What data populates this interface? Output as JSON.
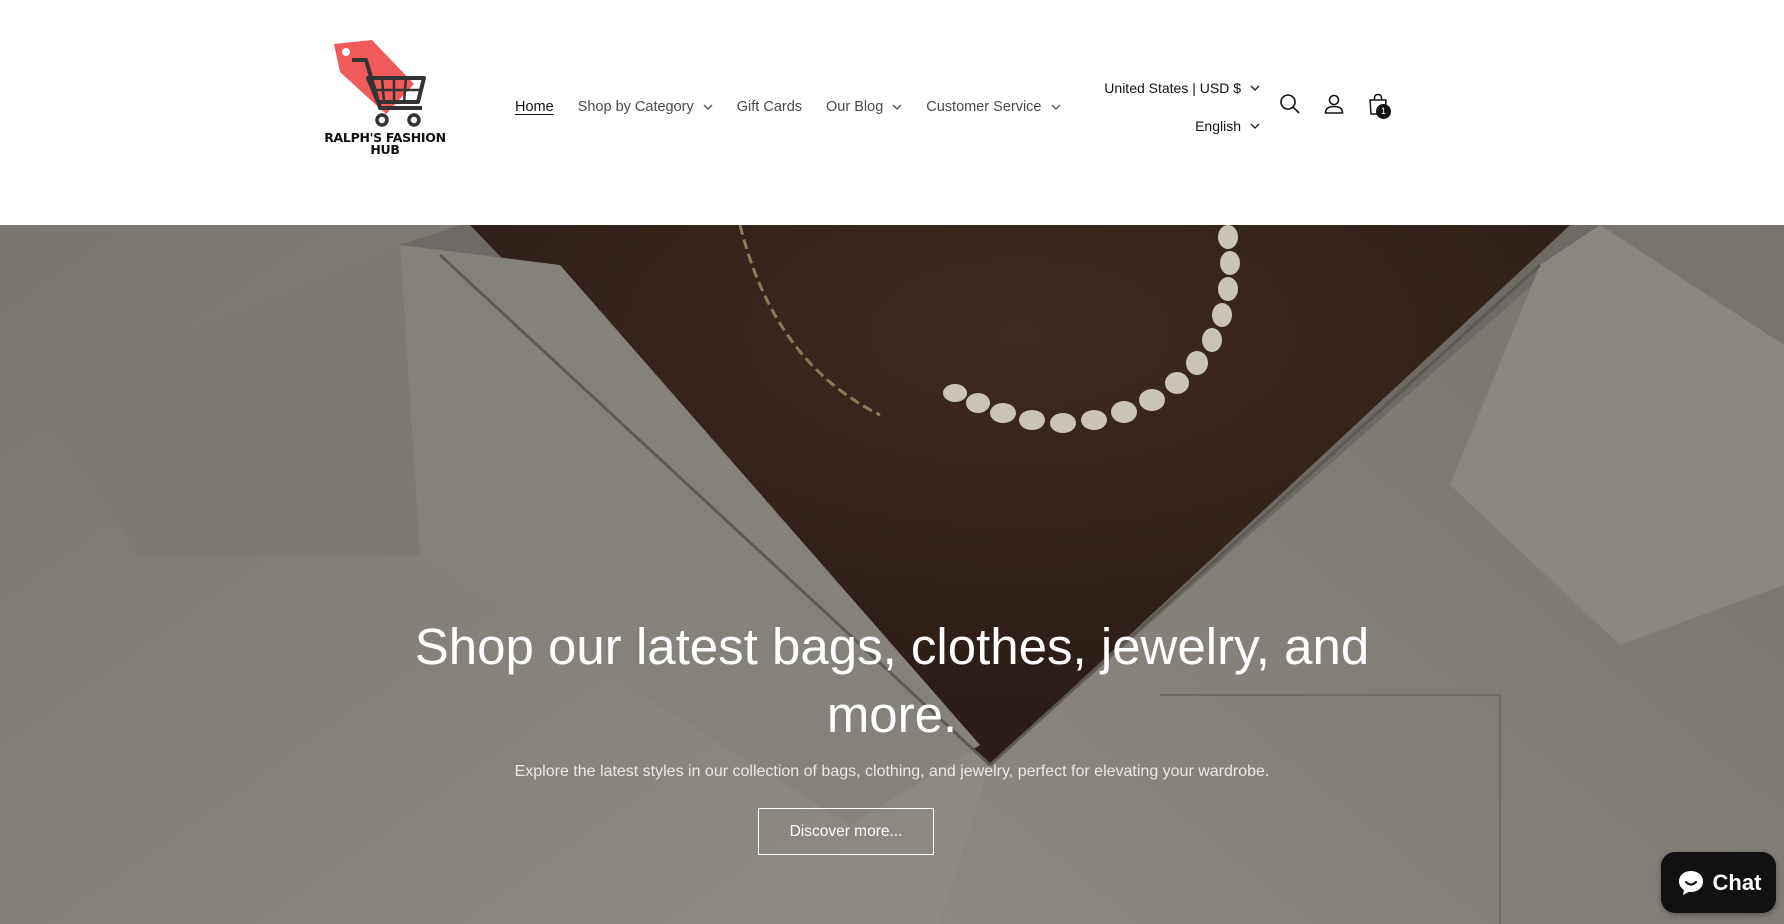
{
  "brand": {
    "name": "RALPH'S FASHION\nHUB",
    "logo_line1": "RALPH'S FASHION",
    "logo_line2": "HUB",
    "accent": "#f05a5a"
  },
  "nav": {
    "items": [
      {
        "label": "Home",
        "active": true
      },
      {
        "label": "Shop by Category",
        "dropdown": true
      },
      {
        "label": "Gift Cards"
      },
      {
        "label": "Our Blog",
        "dropdown": true
      },
      {
        "label": "Customer Service",
        "dropdown": true
      }
    ]
  },
  "locale": {
    "country": "United States | USD $",
    "language": "English"
  },
  "header_icons": [
    "search-icon",
    "account-icon",
    "cart-icon"
  ],
  "cart": {
    "count": "1"
  },
  "hero": {
    "title": "Shop our latest bags, clothes, jewelry, and more.",
    "subtitle": "Explore the latest styles in our collection of bags, clothing, and jewelry, perfect for elevating your wardrobe.",
    "button_label": "Discover more..."
  },
  "chat": {
    "label": "Chat"
  }
}
